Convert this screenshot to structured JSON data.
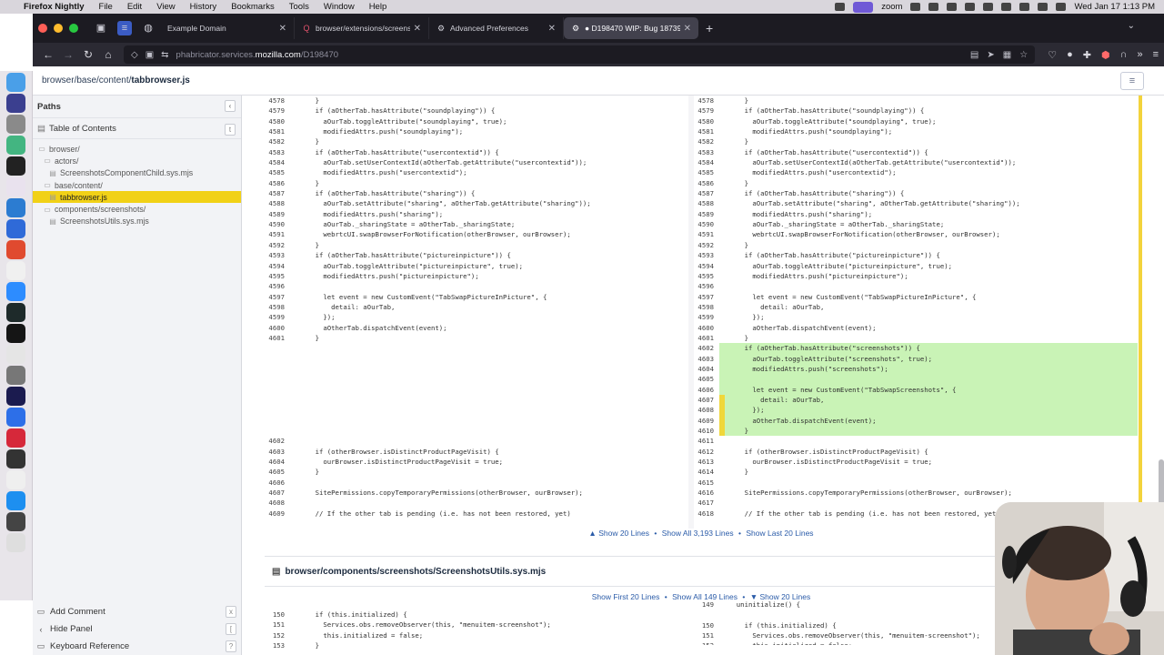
{
  "menubar": {
    "app": "Firefox Nightly",
    "items": [
      "File",
      "Edit",
      "View",
      "History",
      "Bookmarks",
      "Tools",
      "Window",
      "Help"
    ],
    "zoom_label": "zoom",
    "clock": "Wed Jan 17  1:13 PM"
  },
  "tabs": [
    {
      "label": "Example Domain",
      "icon": "globe-icon"
    },
    {
      "label": "browser/extensions/screenshot",
      "icon": "search-icon"
    },
    {
      "label": "Advanced Preferences",
      "icon": "gear-icon"
    },
    {
      "label": "● D198470 WIP: Bug 1873947 -",
      "icon": "gear-icon",
      "active": true
    }
  ],
  "url": {
    "host_prefix": "phabricator.services.",
    "domain": "mozilla.com",
    "path": "/D198470"
  },
  "breadcrumb": {
    "path": "browser/base/content/",
    "file": "tabbrowser.js"
  },
  "sidebar": {
    "paths_title": "Paths",
    "toc_title": "Table of Contents",
    "tree": [
      {
        "label": "browser/",
        "indent": 0,
        "type": "folder"
      },
      {
        "label": "actors/",
        "indent": 1,
        "type": "folder"
      },
      {
        "label": "ScreenshotsComponentChild.sys.mjs",
        "indent": 2,
        "type": "file"
      },
      {
        "label": "base/content/",
        "indent": 1,
        "type": "folder"
      },
      {
        "label": "tabbrowser.js",
        "indent": 2,
        "type": "file",
        "selected": true
      },
      {
        "label": "components/screenshots/",
        "indent": 1,
        "type": "folder"
      },
      {
        "label": "ScreenshotsUtils.sys.mjs",
        "indent": 2,
        "type": "file"
      }
    ],
    "bottom": [
      {
        "label": "Add Comment",
        "icon": "comment-icon",
        "btn": "x"
      },
      {
        "label": "Hide Panel",
        "icon": "chevron-left-icon",
        "btn": "["
      },
      {
        "label": "Keyboard Reference",
        "icon": "keyboard-icon",
        "btn": "?"
      }
    ]
  },
  "diff1": {
    "left": [
      [
        "4578",
        "    }"
      ],
      [
        "4579",
        "    if (aOtherTab.hasAttribute(\"soundplaying\")) {"
      ],
      [
        "4580",
        "      aOurTab.toggleAttribute(\"soundplaying\", true);"
      ],
      [
        "4581",
        "      modifiedAttrs.push(\"soundplaying\");"
      ],
      [
        "4582",
        "    }"
      ],
      [
        "4583",
        "    if (aOtherTab.hasAttribute(\"usercontextid\")) {"
      ],
      [
        "4584",
        "      aOurTab.setUserContextId(aOtherTab.getAttribute(\"usercontextid\"));"
      ],
      [
        "4585",
        "      modifiedAttrs.push(\"usercontextid\");"
      ],
      [
        "4586",
        "    }"
      ],
      [
        "4587",
        "    if (aOtherTab.hasAttribute(\"sharing\")) {"
      ],
      [
        "4588",
        "      aOurTab.setAttribute(\"sharing\", aOtherTab.getAttribute(\"sharing\"));"
      ],
      [
        "4589",
        "      modifiedAttrs.push(\"sharing\");"
      ],
      [
        "4590",
        "      aOurTab._sharingState = aOtherTab._sharingState;"
      ],
      [
        "4591",
        "      webrtcUI.swapBrowserForNotification(otherBrowser, ourBrowser);"
      ],
      [
        "4592",
        "    }"
      ],
      [
        "4593",
        "    if (aOtherTab.hasAttribute(\"pictureinpicture\")) {"
      ],
      [
        "4594",
        "      aOurTab.toggleAttribute(\"pictureinpicture\", true);"
      ],
      [
        "4595",
        "      modifiedAttrs.push(\"pictureinpicture\");"
      ],
      [
        "4596",
        ""
      ],
      [
        "4597",
        "      let event = new CustomEvent(\"TabSwapPictureInPicture\", {"
      ],
      [
        "4598",
        "        detail: aOurTab,"
      ],
      [
        "4599",
        "      });"
      ],
      [
        "4600",
        "      aOtherTab.dispatchEvent(event);"
      ],
      [
        "4601",
        "    }"
      ],
      [
        "",
        ""
      ],
      [
        "",
        ""
      ],
      [
        "",
        ""
      ],
      [
        "",
        ""
      ],
      [
        "",
        ""
      ],
      [
        "",
        ""
      ],
      [
        "",
        ""
      ],
      [
        "",
        ""
      ],
      [
        "",
        ""
      ],
      [
        "4602",
        ""
      ],
      [
        "4603",
        "    if (otherBrowser.isDistinctProductPageVisit) {"
      ],
      [
        "4604",
        "      ourBrowser.isDistinctProductPageVisit = true;"
      ],
      [
        "4605",
        "    }"
      ],
      [
        "4606",
        ""
      ],
      [
        "4607",
        "    SitePermissions.copyTemporaryPermissions(otherBrowser, ourBrowser);"
      ],
      [
        "4608",
        ""
      ],
      [
        "4609",
        "    // If the other tab is pending (i.e. has not been restored, yet)"
      ]
    ],
    "right": [
      [
        "4578",
        "    }",
        "",
        ""
      ],
      [
        "4579",
        "    if (aOtherTab.hasAttribute(\"soundplaying\")) {",
        "",
        ""
      ],
      [
        "4580",
        "      aOurTab.toggleAttribute(\"soundplaying\", true);",
        "",
        ""
      ],
      [
        "4581",
        "      modifiedAttrs.push(\"soundplaying\");",
        "",
        ""
      ],
      [
        "4582",
        "    }",
        "",
        ""
      ],
      [
        "4583",
        "    if (aOtherTab.hasAttribute(\"usercontextid\")) {",
        "",
        ""
      ],
      [
        "4584",
        "      aOurTab.setUserContextId(aOtherTab.getAttribute(\"usercontextid\"));",
        "",
        ""
      ],
      [
        "4585",
        "      modifiedAttrs.push(\"usercontextid\");",
        "",
        ""
      ],
      [
        "4586",
        "    }",
        "",
        ""
      ],
      [
        "4587",
        "    if (aOtherTab.hasAttribute(\"sharing\")) {",
        "",
        ""
      ],
      [
        "4588",
        "      aOurTab.setAttribute(\"sharing\", aOtherTab.getAttribute(\"sharing\"));",
        "",
        ""
      ],
      [
        "4589",
        "      modifiedAttrs.push(\"sharing\");",
        "",
        ""
      ],
      [
        "4590",
        "      aOurTab._sharingState = aOtherTab._sharingState;",
        "",
        ""
      ],
      [
        "4591",
        "      webrtcUI.swapBrowserForNotification(otherBrowser, ourBrowser);",
        "",
        ""
      ],
      [
        "4592",
        "    }",
        "",
        ""
      ],
      [
        "4593",
        "    if (aOtherTab.hasAttribute(\"pictureinpicture\")) {",
        "",
        ""
      ],
      [
        "4594",
        "      aOurTab.toggleAttribute(\"pictureinpicture\", true);",
        "",
        ""
      ],
      [
        "4595",
        "      modifiedAttrs.push(\"pictureinpicture\");",
        "",
        ""
      ],
      [
        "4596",
        "",
        "",
        ""
      ],
      [
        "4597",
        "      let event = new CustomEvent(\"TabSwapPictureInPicture\", {",
        "",
        ""
      ],
      [
        "4598",
        "        detail: aOurTab,",
        "",
        ""
      ],
      [
        "4599",
        "      });",
        "",
        ""
      ],
      [
        "4600",
        "      aOtherTab.dispatchEvent(event);",
        "",
        ""
      ],
      [
        "4601",
        "    }",
        "",
        ""
      ],
      [
        "4602",
        "    if (aOtherTab.hasAttribute(\"screenshots\")) {",
        "add",
        ""
      ],
      [
        "4603",
        "      aOurTab.toggleAttribute(\"screenshots\", true);",
        "add",
        ""
      ],
      [
        "4604",
        "      modifiedAttrs.push(\"screenshots\");",
        "add",
        ""
      ],
      [
        "4605",
        "",
        "add",
        ""
      ],
      [
        "4606",
        "      let event = new CustomEvent(\"TabSwapScreenshots\", {",
        "add",
        ""
      ],
      [
        "4607",
        "        detail: aOurTab,",
        "add",
        "mark"
      ],
      [
        "4608",
        "      });",
        "add",
        "mark"
      ],
      [
        "4609",
        "      aOtherTab.dispatchEvent(event);",
        "add",
        "mark"
      ],
      [
        "4610",
        "    }",
        "add",
        "mark"
      ],
      [
        "4611",
        "",
        "",
        ""
      ],
      [
        "4612",
        "    if (otherBrowser.isDistinctProductPageVisit) {",
        "",
        ""
      ],
      [
        "4613",
        "      ourBrowser.isDistinctProductPageVisit = true;",
        "",
        ""
      ],
      [
        "4614",
        "    }",
        "",
        ""
      ],
      [
        "4615",
        "",
        "",
        ""
      ],
      [
        "4616",
        "    SitePermissions.copyTemporaryPermissions(otherBrowser, ourBrowser);",
        "",
        ""
      ],
      [
        "4617",
        "",
        "",
        ""
      ],
      [
        "4618",
        "    // If the other tab is pending (i.e. has not been restored, yet)",
        "",
        ""
      ]
    ]
  },
  "show1": {
    "prefix": "▲ ",
    "a": "Show 20 Lines",
    "b": "Show All 3,193 Lines",
    "c": "Show Last 20 Lines",
    "sep": "•"
  },
  "file2": {
    "path": "browser/components/screenshots/ScreenshotsUtils.sys.mjs"
  },
  "show2": {
    "a": "Show First 20 Lines",
    "b": "Show All 149 Lines",
    "c": "▼ Show 20 Lines",
    "sep": "•"
  },
  "diff2": {
    "left": [
      [
        "150",
        "    if (this.initialized) {"
      ],
      [
        "151",
        "      Services.obs.removeObserver(this, \"menuitem-screenshot\");"
      ],
      [
        "152",
        "      this.initialized = false;"
      ],
      [
        "153",
        "    }"
      ]
    ],
    "right": [
      [
        "149",
        "  uninitialize() {"
      ],
      [
        "",
        ""
      ],
      [
        "150",
        "    if (this.initialized) {"
      ],
      [
        "151",
        "      Services.obs.removeObserver(this, \"menuitem-screenshot\");"
      ],
      [
        "152",
        "      this.initialized = false;"
      ],
      [
        "153",
        "    }"
      ]
    ]
  },
  "colors": {
    "accent_selected": "#f1d117",
    "added_line": "#c9f3b6",
    "link": "#2a5ba8"
  }
}
